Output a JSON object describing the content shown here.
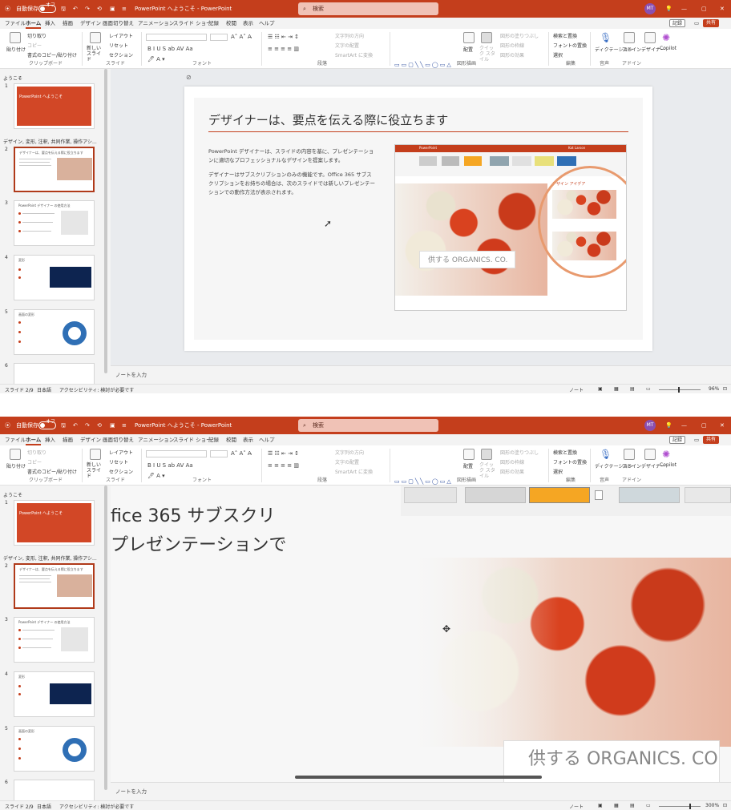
{
  "titlebar": {
    "autosave": "自動保存",
    "autosave_state": "オフ",
    "doc_title": "PowerPoint へようこそ - PowerPoint",
    "search_placeholder": "検索",
    "user_initials": "MT",
    "minimize": "—",
    "restore": "▢",
    "close": "✕"
  },
  "tabs": [
    "ファイル",
    "ホーム",
    "挿入",
    "描画",
    "デザイン",
    "画面切り替え",
    "アニメーション",
    "スライド ショー",
    "記録",
    "校閲",
    "表示",
    "ヘルプ"
  ],
  "tabs_right": {
    "record": "記録",
    "share": "共有"
  },
  "ribbon": {
    "paste": "貼り付け",
    "cut": "切り取り",
    "copy": "コピー",
    "format_painter": "書式のコピー/貼り付け",
    "clipboard_group": "クリップボード",
    "new_slide": "新しい スライド",
    "layout": "レイアウト",
    "reset": "リセット",
    "section": "セクション",
    "slides_group": "スライド",
    "font_group": "フォント",
    "paragraph_group": "段落",
    "text_direction": "文字列の方向",
    "align_text": "文字の配置",
    "smartart": "SmartArt に変換",
    "drawing_group": "図形描画",
    "arrange": "配置",
    "quick_styles": "クイック スタイル",
    "shape_fill": "図形の塗りつぶし",
    "shape_outline": "図形の枠線",
    "shape_effects": "図形の効果",
    "find": "検索と置換",
    "replace": "フォントの置換",
    "select": "選択",
    "editing_group": "編集",
    "dictate": "ディクテーション",
    "voice_group": "音声",
    "addins": "アドイン",
    "designer": "デザイナー",
    "copilot": "Copilot",
    "addins_group": "アドイン"
  },
  "panel": {
    "section1": "ようこそ",
    "section2": "デザイン, 変形, 注釈, 共同作業, 操作アシ...",
    "slides": [
      {
        "num": "1",
        "title": "PowerPoint へようこそ"
      },
      {
        "num": "2",
        "title": "デザイナーは、要点を伝える際に役立ちます"
      },
      {
        "num": "3",
        "title": "PowerPoint デザイナー の使用方法"
      },
      {
        "num": "4",
        "title": "変形"
      },
      {
        "num": "5",
        "title": "画面の変形"
      },
      {
        "num": "6",
        "title": ""
      }
    ]
  },
  "slide": {
    "title": "デザイナーは、要点を伝える際に役立ちます",
    "para1": "PowerPoint デザイナーは、スライドの内容を基に、プレゼンテーションに適切なプロフェッショナルなデザインを提案します。",
    "para2": "デザイナーはサブスクリプションのみの機能です。Office 365 サブスクリプションをお持ちの場合は、次のスライドでは新しいプレゼンテーションでの動作方法が表示されます。",
    "shot_app": "PowerPoint",
    "shot_user": "Kat Larson",
    "design_ideas": "デザイン アイデア",
    "organics": "供する ORGANICS. CO.",
    "organics_small": "新鮮な自然食品を提供する ORGANICS. CO."
  },
  "zoomed": {
    "line1": "fice 365 サブスクリ",
    "line2": "プレゼンテーションで",
    "organics": "供する ORGANICS. CO"
  },
  "notes": "ノートを入力",
  "status": {
    "slide_count": "スライド 2/9",
    "language": "日本語",
    "accessibility": "アクセシビリティ: 検討が必要です",
    "notes_btn": "ノート",
    "zoom1": "96%",
    "zoom2": "300%"
  },
  "colors": {
    "accent": "#c43e1c",
    "panel": "#f3f3f3"
  }
}
